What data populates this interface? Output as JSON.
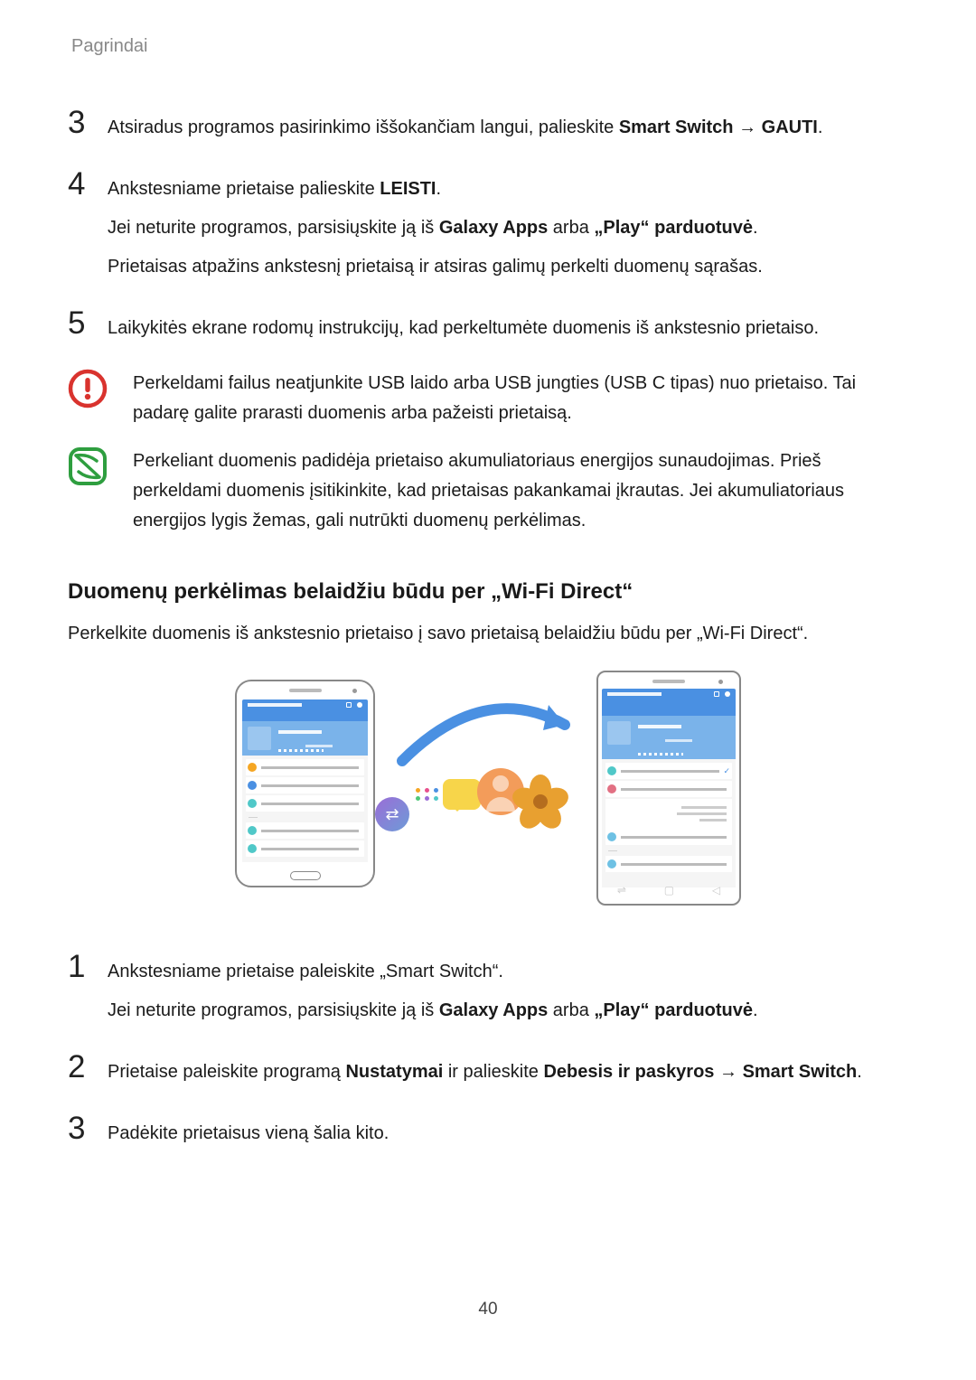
{
  "header": {
    "title": "Pagrindai"
  },
  "steps_a": [
    {
      "num": "3",
      "parts": [
        {
          "t": "Atsiradus programos pasirinkimo iššokančiam langui, palieskite ",
          "b": false
        },
        {
          "t": "Smart Switch",
          "b": true
        },
        {
          "t": " → ",
          "b": false,
          "arrow": true
        },
        {
          "t": "GAUTI",
          "b": true
        },
        {
          "t": ".",
          "b": false
        }
      ]
    },
    {
      "num": "4",
      "lines": [
        [
          {
            "t": "Ankstesniame prietaise palieskite ",
            "b": false
          },
          {
            "t": "LEISTI",
            "b": true
          },
          {
            "t": ".",
            "b": false
          }
        ],
        [
          {
            "t": "Jei neturite programos, parsisiųskite ją iš ",
            "b": false
          },
          {
            "t": "Galaxy Apps",
            "b": true
          },
          {
            "t": " arba ",
            "b": false
          },
          {
            "t": "„Play“ parduotuvė",
            "b": true
          },
          {
            "t": ".",
            "b": false
          }
        ],
        [
          {
            "t": "Prietaisas atpažins ankstesnį prietaisą ir atsiras galimų perkelti duomenų sąrašas.",
            "b": false
          }
        ]
      ]
    },
    {
      "num": "5",
      "parts": [
        {
          "t": "Laikykitės ekrane rodomų instrukcijų, kad perkeltumėte duomenis iš ankstesnio prietaiso.",
          "b": false
        }
      ]
    }
  ],
  "warning": {
    "text": "Perkeldami failus neatjunkite USB laido arba USB jungties (USB C tipas) nuo prietaiso. Tai padarę galite prarasti duomenis arba pažeisti prietaisą."
  },
  "tip": {
    "text": "Perkeliant duomenis padidėja prietaiso akumuliatoriaus energijos sunaudojimas. Prieš perkeldami duomenis įsitikinkite, kad prietaisas pakankamai įkrautas. Jei akumuliatoriaus energijos lygis žemas, gali nutrūkti duomenų perkėlimas."
  },
  "section": {
    "heading": "Duomenų perkėlimas belaidžiu būdu per „Wi-Fi Direct“",
    "intro": "Perkelkite duomenis iš ankstesnio prietaiso į savo prietaisą belaidžiu būdu per „Wi-Fi Direct“."
  },
  "steps_b": [
    {
      "num": "1",
      "lines": [
        [
          {
            "t": "Ankstesniame prietaise paleiskite „Smart Switch“.",
            "b": false
          }
        ],
        [
          {
            "t": "Jei neturite programos, parsisiųskite ją iš ",
            "b": false
          },
          {
            "t": "Galaxy Apps",
            "b": true
          },
          {
            "t": " arba ",
            "b": false
          },
          {
            "t": "„Play“ parduotuvė",
            "b": true
          },
          {
            "t": ".",
            "b": false
          }
        ]
      ]
    },
    {
      "num": "2",
      "parts": [
        {
          "t": "Prietaise paleiskite programą ",
          "b": false
        },
        {
          "t": "Nustatymai",
          "b": true
        },
        {
          "t": " ir palieskite ",
          "b": false
        },
        {
          "t": "Debesis ir paskyros",
          "b": true
        },
        {
          "t": " → ",
          "b": false,
          "arrow": true
        },
        {
          "t": "Smart Switch",
          "b": true
        },
        {
          "t": ".",
          "b": false
        }
      ]
    },
    {
      "num": "3",
      "parts": [
        {
          "t": "Padėkite prietaisus vieną šalia kito.",
          "b": false
        }
      ]
    }
  ],
  "page_number": "40"
}
